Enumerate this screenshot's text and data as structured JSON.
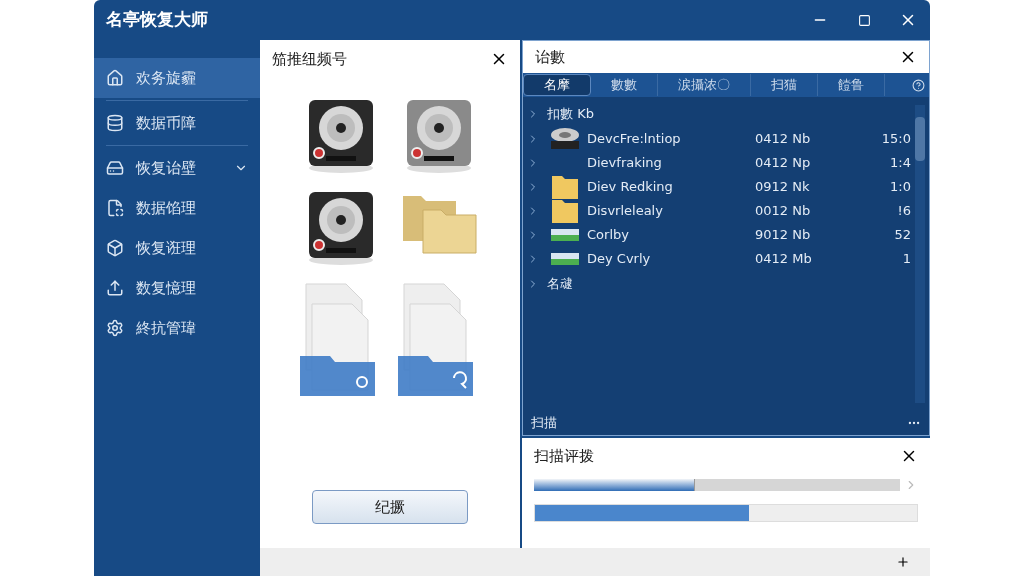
{
  "window": {
    "title": "名亭恢复大师"
  },
  "sidebar": {
    "items": [
      {
        "label": "欢务旋霾",
        "selected": true,
        "expandable": false
      },
      {
        "label": "数据币障",
        "selected": false,
        "expandable": false
      },
      {
        "label": "恢复诒壁",
        "selected": false,
        "expandable": true
      },
      {
        "label": "数据馅理",
        "selected": false,
        "expandable": false
      },
      {
        "label": "恢复诳理",
        "selected": false,
        "expandable": false
      },
      {
        "label": "数复憶理",
        "selected": false,
        "expandable": false
      },
      {
        "label": "終抗管瑋",
        "selected": false,
        "expandable": false
      }
    ]
  },
  "source_panel": {
    "title": "笳推纽频号",
    "button": "纪撅"
  },
  "results_panel": {
    "title": "诒數",
    "tabs": [
      {
        "label": "名摩",
        "selected": true
      },
      {
        "label": "數數",
        "selected": false
      },
      {
        "label": "涙攝浓〇",
        "selected": false
      },
      {
        "label": "扫猫",
        "selected": false
      },
      {
        "label": "饐鲁",
        "selected": false
      }
    ],
    "rows": [
      {
        "kind": "group",
        "name": "扣數 Kb"
      },
      {
        "kind": "disk",
        "name": "DevcFre:lntiop",
        "size": "0412 Nb",
        "count": "15:0"
      },
      {
        "kind": "plain",
        "name": "Dievfraking",
        "size": "0412 Np",
        "count": "1:4"
      },
      {
        "kind": "folder",
        "name": "Diev Redking",
        "size": "0912 Nk",
        "count": "1:0"
      },
      {
        "kind": "folder",
        "name": "Disvrlelealy",
        "size": "0012 Nb",
        "count": "!6"
      },
      {
        "kind": "drive",
        "name": "Corlby",
        "size": "9012 Nb",
        "count": "52"
      },
      {
        "kind": "drive",
        "name": "Dey Cvrly",
        "size": "0412 Mb",
        "count": "1"
      },
      {
        "kind": "group",
        "name": "名叇"
      }
    ],
    "footer": "扫描"
  },
  "progress_panel": {
    "title": "扫描评拨",
    "slider": {
      "level": 0.44
    },
    "bar": {
      "level": 0.56
    }
  }
}
